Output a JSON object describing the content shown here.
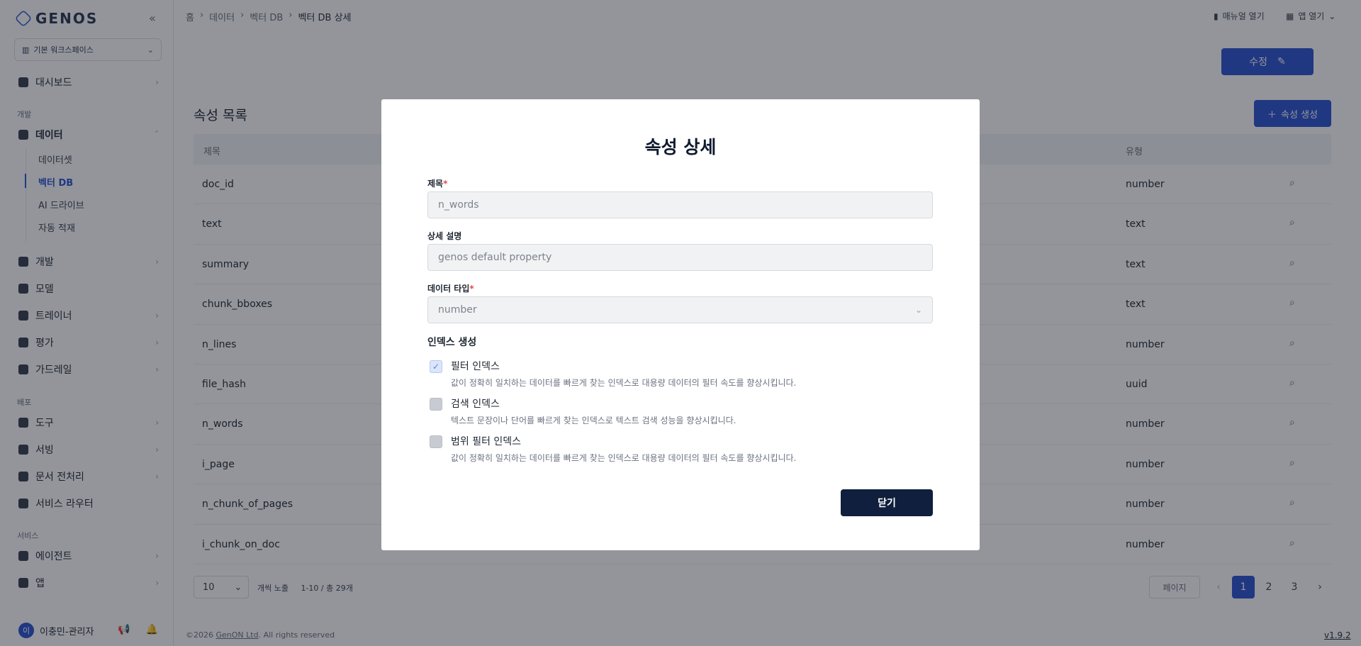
{
  "app": {
    "logo": "GENOS",
    "workspace": "기본 워크스페이스"
  },
  "sidebar": {
    "dashboard": "대시보드",
    "section_dev": "개발",
    "data": "데이터",
    "data_children": [
      "데이터셋",
      "벡터 DB",
      "AI 드라이브",
      "자동 적재"
    ],
    "dev": "개발",
    "model": "모델",
    "trainer": "트레이너",
    "eval": "평가",
    "guardrail": "가드레일",
    "section_deploy": "배포",
    "tools": "도구",
    "serving": "서빙",
    "docproc": "문서 전처리",
    "router": "서비스 라우터",
    "section_service": "서비스",
    "agent": "에이전트",
    "app": "앱",
    "user_initial": "이",
    "user_name": "이충민-관리자"
  },
  "breadcrumb": [
    "홈",
    "데이터",
    "벡터 DB",
    "벡터 DB 상세"
  ],
  "topbar": {
    "manual": "매뉴얼 열기",
    "app_open": "앱 열기"
  },
  "page": {
    "edit_label": "수정",
    "section_title": "속성 목록",
    "create_label": "속성 생성",
    "col_title": "제목",
    "col_type": "유형"
  },
  "table": {
    "rows": [
      {
        "name": "doc_id",
        "type": "number"
      },
      {
        "name": "text",
        "type": "text"
      },
      {
        "name": "summary",
        "type": "text"
      },
      {
        "name": "chunk_bboxes",
        "type": "text"
      },
      {
        "name": "n_lines",
        "type": "number"
      },
      {
        "name": "file_hash",
        "type": "uuid"
      },
      {
        "name": "n_words",
        "type": "number"
      },
      {
        "name": "i_page",
        "type": "number"
      },
      {
        "name": "n_chunk_of_pages",
        "type": "number"
      },
      {
        "name": "i_chunk_on_doc",
        "type": "number"
      }
    ]
  },
  "pagination": {
    "page_size": "10",
    "page_size_label": "개씩 노출",
    "range": "1-10 / 총 29개",
    "page_label": "페이지",
    "pages": [
      "1",
      "2",
      "3"
    ],
    "current": "1"
  },
  "footer": {
    "copyright_prefix": "©2026",
    "company": "GenON Ltd",
    "rights": ". All rights reserved",
    "version": "v1.9.2"
  },
  "modal": {
    "title": "속성 상세",
    "field_title_label": "제목",
    "field_title_value": "n_words",
    "field_desc_label": "상세 설명",
    "field_desc_value": "genos default property",
    "field_type_label": "데이터 타입",
    "field_type_value": "number",
    "index_section": "인덱스 생성",
    "indexes": [
      {
        "title": "필터 인덱스",
        "desc": "값이 정확히 일치하는 데이터를 빠르게 찾는 인덱스로 대용량 데이터의 필터 속도를 향상시킵니다.",
        "checked": true
      },
      {
        "title": "검색 인덱스",
        "desc": "텍스트 문장이나 단어를 빠르게 찾는 인덱스로 텍스트 검색 성능을 향상시킵니다.",
        "checked": false
      },
      {
        "title": "범위 필터 인덱스",
        "desc": "값이 정확히 일치하는 데이터를 빠르게 찾는 인덱스로 대용량 데이터의 필터 속도를 향상시킵니다.",
        "checked": false
      }
    ],
    "close_label": "닫기"
  },
  "colors": {
    "accent": "#2f55d4",
    "close_button": "#0f1f3d",
    "required": "#e5484d"
  }
}
